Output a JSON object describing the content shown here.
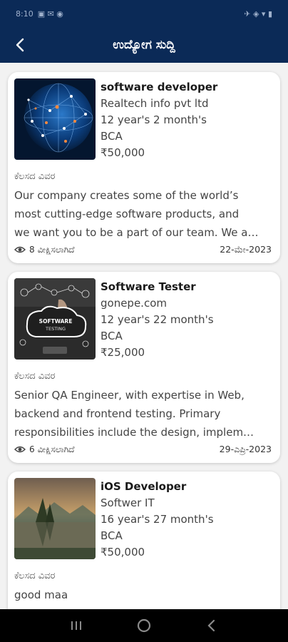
{
  "status_bar": {
    "time": "8:10",
    "left_glyphs": "▣ ✉ ◉",
    "right_glyphs": "✈ ◈ ▾ ▮"
  },
  "app_bar": {
    "title": "ಉದ್ಯೋಗ ಸುದ್ದಿ",
    "back_icon": "arrow-left-icon"
  },
  "colors": {
    "header": "#0b2a57",
    "card": "#ffffff",
    "background": "#f2f2f2"
  },
  "jobs": [
    {
      "title": "software developer",
      "company": "Realtech info pvt ltd",
      "experience": "12 year's 2 month's",
      "qualification": "BCA",
      "salary": "₹50,000",
      "description_label": "ಕೆಲಸದ ವಿವರ",
      "description_lines": [
        "Our company creates some of the world’s",
        "most cutting-edge software products, and",
        "we want you to be a part of our team. We a…"
      ],
      "views_count": "8",
      "views_label": "ವೀಕ್ಷಿಸಲಾಗಿದೆ",
      "date": "22-ಮೇ-2023"
    },
    {
      "title": "Software Tester",
      "company": "gonepe.com",
      "experience": "12 year's 22 month's",
      "qualification": "BCA",
      "salary": "₹25,000",
      "description_label": "ಕೆಲಸದ ವಿವರ",
      "description_lines": [
        "Senior QA Engineer, with expertise in Web,",
        "backend and frontend testing. Primary",
        "responsibilities include the design, implem…"
      ],
      "views_count": "6",
      "views_label": "ವೀಕ್ಷಿಸಲಾಗಿದೆ",
      "date": "29-ಎಪ್ರಿ-2023",
      "thumb_text_1": "SOFTWARE",
      "thumb_text_2": "TESTING"
    },
    {
      "title": "iOS Developer",
      "company": "Softwer IT",
      "experience": "16 year's 27 month's",
      "qualification": "BCA",
      "salary": "₹50,000",
      "description_label": "ಕೆಲಸದ ವಿವರ",
      "description_lines": [
        "good maa"
      ]
    }
  ]
}
